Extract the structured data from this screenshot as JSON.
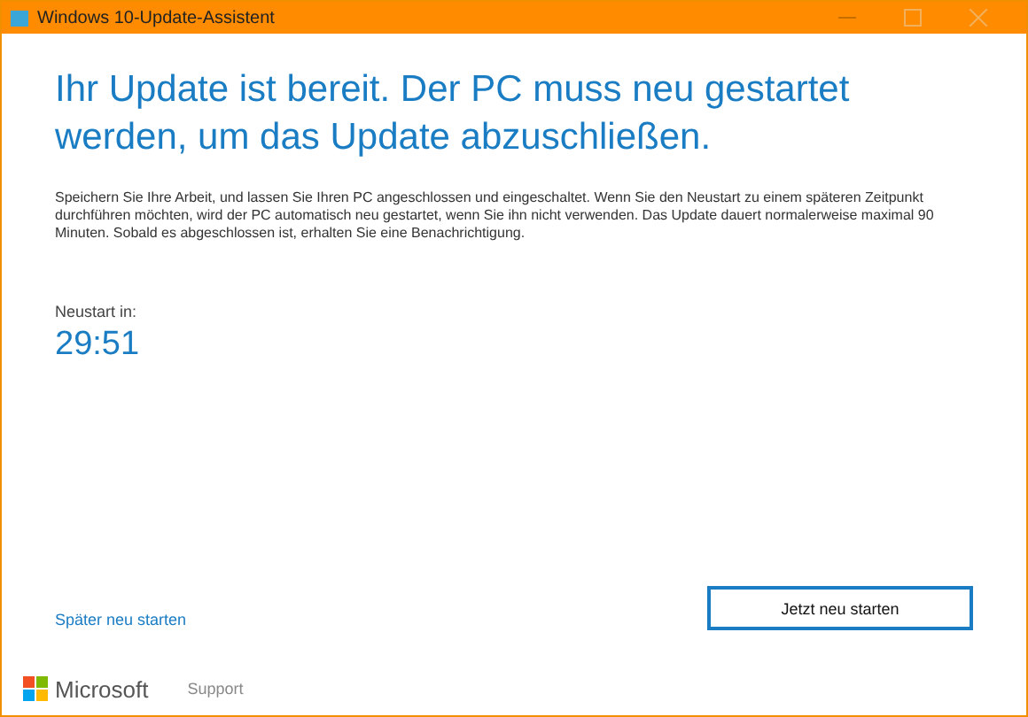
{
  "window": {
    "title": "Windows 10-Update-Assistent"
  },
  "heading": "Ihr Update ist bereit. Der PC muss neu gestartet werden, um das Update abzuschließen.",
  "description": "Speichern Sie Ihre Arbeit, und lassen Sie Ihren PC angeschlossen und eingeschaltet. Wenn Sie den Neustart zu einem späteren Zeitpunkt durchführen möchten, wird der PC automatisch neu gestartet, wenn Sie ihn nicht verwenden. Das Update dauert normalerweise maximal 90 Minuten. Sobald es abgeschlossen ist, erhalten Sie eine Benachrichtigung.",
  "countdown": {
    "label": "Neustart in:",
    "value": "29:51"
  },
  "later_link": "Später neu starten",
  "restart_button": "Jetzt neu starten",
  "footer": {
    "brand": "Microsoft",
    "support": "Support"
  }
}
